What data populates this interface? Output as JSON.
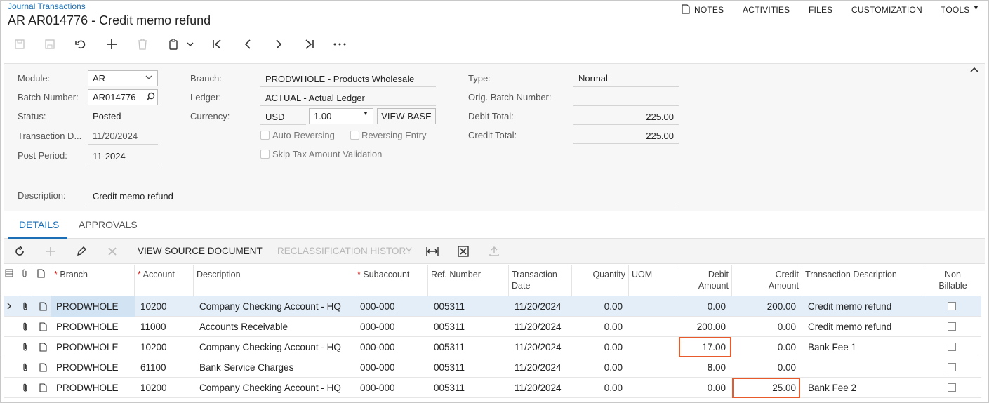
{
  "breadcrumb": "Journal Transactions",
  "page_title": "AR AR014776 - Credit memo refund",
  "top_nav": {
    "notes": "NOTES",
    "activities": "ACTIVITIES",
    "files": "FILES",
    "customization": "CUSTOMIZATION",
    "tools": "TOOLS"
  },
  "form": {
    "module_label": "Module:",
    "module_value": "AR",
    "batch_number_label": "Batch Number:",
    "batch_number_value": "AR014776",
    "status_label": "Status:",
    "status_value": "Posted",
    "transaction_date_label": "Transaction D...",
    "transaction_date_value": "11/20/2024",
    "post_period_label": "Post Period:",
    "post_period_value": "11-2024",
    "description_label": "Description:",
    "description_value": "Credit memo refund",
    "branch_label": "Branch:",
    "branch_value": "PRODWHOLE - Products Wholesale",
    "ledger_label": "Ledger:",
    "ledger_value": "ACTUAL - Actual Ledger",
    "currency_label": "Currency:",
    "currency_value": "USD",
    "rate_value": "1.00",
    "view_base_label": "VIEW BASE",
    "auto_reversing_label": "Auto Reversing",
    "reversing_entry_label": "Reversing Entry",
    "skip_tax_label": "Skip Tax Amount Validation",
    "type_label": "Type:",
    "type_value": "Normal",
    "orig_batch_label": "Orig. Batch Number:",
    "orig_batch_value": "",
    "debit_total_label": "Debit Total:",
    "debit_total_value": "225.00",
    "credit_total_label": "Credit Total:",
    "credit_total_value": "225.00"
  },
  "tabs": {
    "details": "DETAILS",
    "approvals": "APPROVALS"
  },
  "grid_toolbar": {
    "view_source": "VIEW SOURCE DOCUMENT",
    "reclass_history": "RECLASSIFICATION HISTORY"
  },
  "columns": {
    "branch": "Branch",
    "account": "Account",
    "description": "Description",
    "subaccount": "Subaccount",
    "ref_number": "Ref. Number",
    "transaction_date_1": "Transaction",
    "transaction_date_2": "Date",
    "quantity": "Quantity",
    "uom": "UOM",
    "debit_1": "Debit",
    "debit_2": "Amount",
    "credit_1": "Credit",
    "credit_2": "Amount",
    "trans_desc": "Transaction Description",
    "non_billable_1": "Non",
    "non_billable_2": "Billable"
  },
  "rows": [
    {
      "branch": "PRODWHOLE",
      "account": "10200",
      "description": "Company Checking Account - HQ",
      "subaccount": "000-000",
      "ref": "005311",
      "date": "11/20/2024",
      "quantity": "0.00",
      "uom": "",
      "debit": "0.00",
      "credit": "200.00",
      "trans_desc": "Credit memo refund"
    },
    {
      "branch": "PRODWHOLE",
      "account": "11000",
      "description": "Accounts Receivable",
      "subaccount": "000-000",
      "ref": "005311",
      "date": "11/20/2024",
      "quantity": "0.00",
      "uom": "",
      "debit": "200.00",
      "credit": "0.00",
      "trans_desc": "Credit memo refund"
    },
    {
      "branch": "PRODWHOLE",
      "account": "10200",
      "description": "Company Checking Account - HQ",
      "subaccount": "000-000",
      "ref": "005311",
      "date": "11/20/2024",
      "quantity": "0.00",
      "uom": "",
      "debit": "17.00",
      "credit": "0.00",
      "trans_desc": "Bank Fee 1"
    },
    {
      "branch": "PRODWHOLE",
      "account": "61100",
      "description": "Bank Service Charges",
      "subaccount": "000-000",
      "ref": "005311",
      "date": "11/20/2024",
      "quantity": "0.00",
      "uom": "",
      "debit": "8.00",
      "credit": "0.00",
      "trans_desc": ""
    },
    {
      "branch": "PRODWHOLE",
      "account": "10200",
      "description": "Company Checking Account - HQ",
      "subaccount": "000-000",
      "ref": "005311",
      "date": "11/20/2024",
      "quantity": "0.00",
      "uom": "",
      "debit": "0.00",
      "credit": "25.00",
      "trans_desc": "Bank Fee 2"
    }
  ],
  "colors": {
    "accent": "#1c6fb5",
    "highlight": "#e85a2c",
    "selected_row": "#e3eef8"
  }
}
